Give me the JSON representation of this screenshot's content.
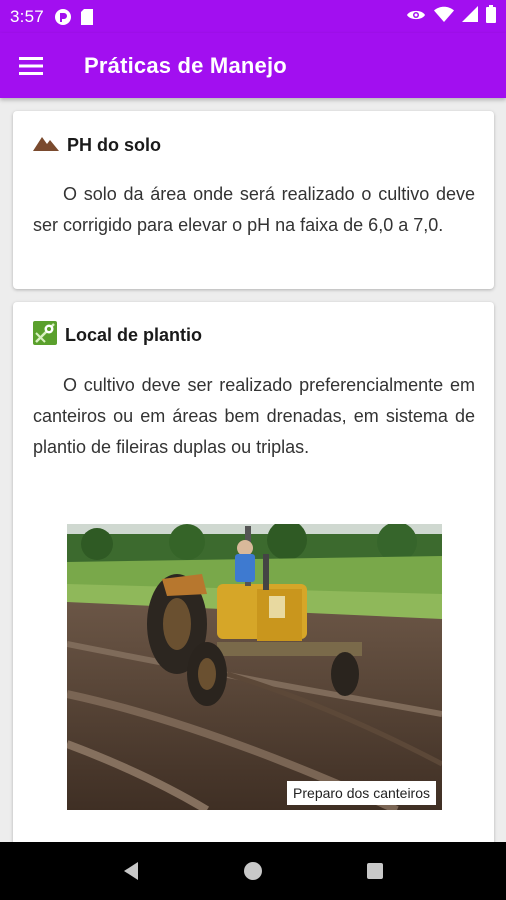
{
  "status_bar": {
    "time": "3:57",
    "icons_left": [
      "pocket-icon",
      "sd-card-icon"
    ],
    "icons_right": [
      "eye-icon",
      "wifi-icon",
      "signal-icon",
      "battery-icon"
    ]
  },
  "app_bar": {
    "title": "Práticas de Manejo",
    "menu_icon": "menu-icon"
  },
  "cards": [
    {
      "icon": "terrain-icon",
      "title": "PH do solo",
      "text": "O solo da área onde será realizado o cultivo deve ser corrigido para elevar o pH na faixa de 6,0 a 7,0."
    },
    {
      "icon": "map-marker-icon",
      "title": "Local de plantio",
      "text": "O cultivo deve ser realizado preferencialmente em canteiros ou em áreas bem drenadas, em sistema de plantio de fileiras duplas ou triplas.",
      "image_caption": "Preparo dos canteiros"
    }
  ],
  "nav_bar": {
    "buttons": [
      "back-icon",
      "home-icon",
      "recents-icon"
    ]
  },
  "colors": {
    "primary": "#a20ff0",
    "terrain_icon": "#7a4a2e",
    "map_icon": "#5aa02c"
  }
}
